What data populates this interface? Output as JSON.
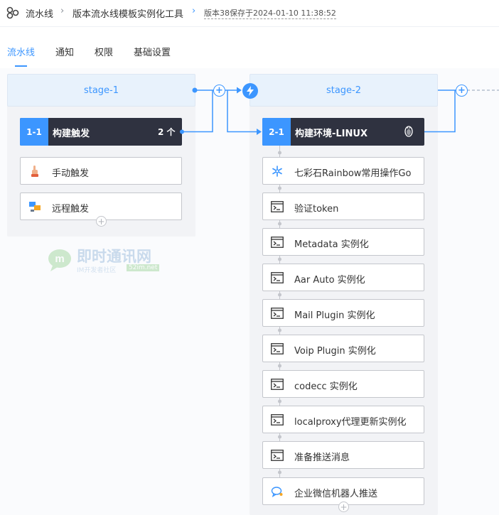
{
  "breadcrumb": {
    "root": "流水线",
    "template": "版本流水线模板实例化工具",
    "version": "版本38保存于2024-01-10 11:38:52"
  },
  "tabs": [
    {
      "label": "流水线",
      "active": true
    },
    {
      "label": "通知",
      "active": false
    },
    {
      "label": "权限",
      "active": false
    },
    {
      "label": "基础设置",
      "active": false
    }
  ],
  "watermark": {
    "title": "即时通讯网",
    "subtitle": "IM开发者社区",
    "domain": "52im.net"
  },
  "stages": [
    {
      "name": "stage-1",
      "job": {
        "id": "1-1",
        "title": "构建触发",
        "count": "2 个"
      },
      "atoms": [
        {
          "label": "手动触发",
          "icon": "hand-pointer-icon"
        },
        {
          "label": "远程触发",
          "icon": "remote-trigger-icon"
        }
      ]
    },
    {
      "name": "stage-2",
      "job": {
        "id": "2-1",
        "title": "构建环境-LINUX",
        "os_icon": "linux-penguin-icon"
      },
      "atoms": [
        {
          "label": "七彩石Rainbow常用操作Go",
          "icon": "snowflake-icon"
        },
        {
          "label": "验证token",
          "icon": "terminal-icon"
        },
        {
          "label": "Metadata 实例化",
          "icon": "terminal-icon"
        },
        {
          "label": "Aar Auto 实例化",
          "icon": "terminal-icon"
        },
        {
          "label": "Mail Plugin 实例化",
          "icon": "terminal-icon"
        },
        {
          "label": "Voip Plugin 实例化",
          "icon": "terminal-icon"
        },
        {
          "label": "codecc 实例化",
          "icon": "terminal-icon"
        },
        {
          "label": "localproxy代理更新实例化",
          "icon": "terminal-icon"
        },
        {
          "label": "准备推送消息",
          "icon": "terminal-icon"
        },
        {
          "label": "企业微信机器人推送",
          "icon": "chat-bubble-icon"
        }
      ]
    }
  ],
  "colors": {
    "accent": "#3c96ff",
    "job_header": "#2f3240",
    "stage_header": "#e8f2fc",
    "stage_body": "#f2f3f6"
  }
}
